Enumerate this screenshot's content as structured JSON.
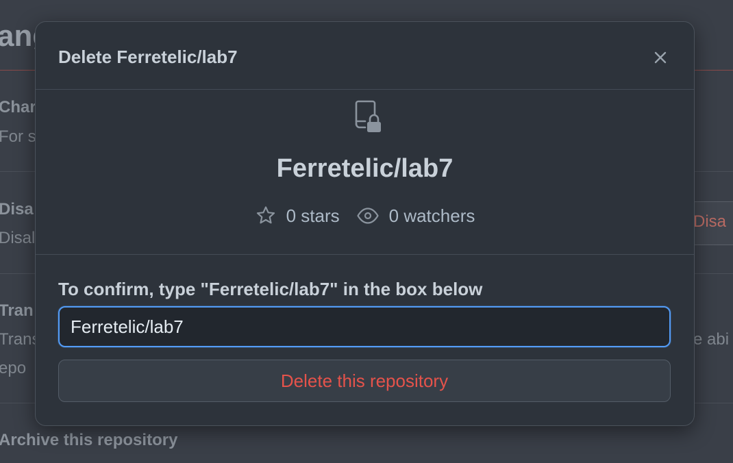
{
  "background": {
    "heading": "ange",
    "rows": [
      {
        "title": "Char",
        "desc": "For s"
      },
      {
        "title": "Disa",
        "desc": "Disal"
      },
      {
        "title": "Tran",
        "desc": "Trans",
        "desc2": "epo"
      },
      {
        "title": "Archive this repository"
      }
    ],
    "right_button_label": "Disa",
    "right_text": "e abi"
  },
  "modal": {
    "title": "Delete Ferretelic/lab7",
    "close_icon": "x-icon",
    "repo_icon": "repo-locked-icon",
    "repo_name": "Ferretelic/lab7",
    "stars_label": "0 stars",
    "watchers_label": "0 watchers",
    "confirm_label": "To confirm, type \"Ferretelic/lab7\" in the box below",
    "input_value": "Ferretelic/lab7",
    "delete_label": "Delete this repository"
  },
  "colors": {
    "accent_focus": "#539bf5",
    "danger": "#e5534b",
    "surface": "#2d333b"
  }
}
